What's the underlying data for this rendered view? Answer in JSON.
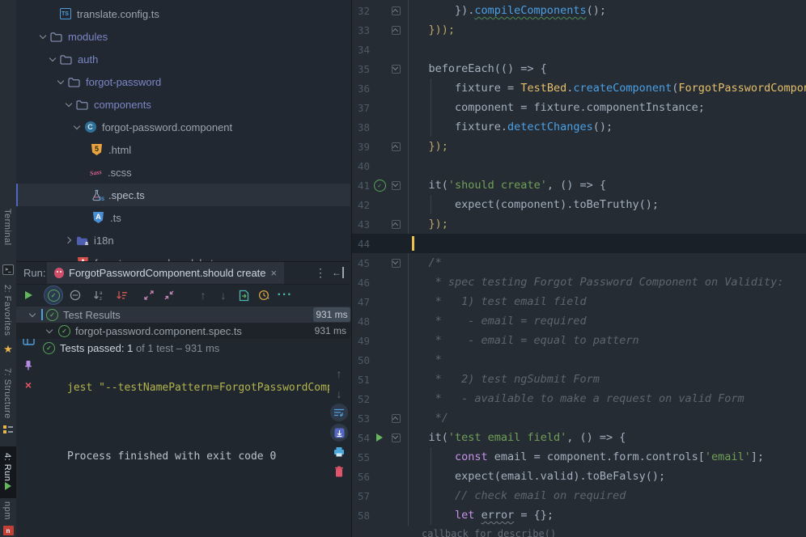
{
  "colors": {
    "accent_green": "#64b75d",
    "status_green": "#57a559",
    "error_red": "#e05561",
    "folder_blue": "#7b87c6",
    "keyword_purple": "#c792ea",
    "string_green": "#70a157",
    "class_yellow": "#e5bf6a",
    "method_blue": "#4aa0e5",
    "console_command_yellow": "#b3b44d"
  },
  "stripe": {
    "items": [
      {
        "id": "terminal",
        "label": "Terminal",
        "active": false
      },
      {
        "id": "favorites",
        "label": "2: Favorites",
        "active": false
      },
      {
        "id": "structure",
        "label": "7: Structure",
        "active": false
      },
      {
        "id": "run",
        "label": "4: Run",
        "active": true
      },
      {
        "id": "npm",
        "label": "npm",
        "active": false
      }
    ]
  },
  "project_tree": {
    "items": [
      {
        "label": "translate.config.ts",
        "icon": "ts-file",
        "indent": 52
      },
      {
        "label": "modules",
        "icon": "folder",
        "chevron": "open",
        "indent": 28,
        "kind": "folder"
      },
      {
        "label": "auth",
        "icon": "folder",
        "chevron": "open",
        "indent": 40,
        "kind": "folder"
      },
      {
        "label": "forgot-password",
        "icon": "folder",
        "chevron": "open",
        "indent": 50,
        "kind": "folder"
      },
      {
        "label": "components",
        "icon": "folder",
        "chevron": "open",
        "indent": 60,
        "kind": "folder"
      },
      {
        "label": "forgot-password.component",
        "icon": "component",
        "chevron": "open",
        "indent": 70
      },
      {
        "label": ".html",
        "icon": "html",
        "indent": 91
      },
      {
        "label": ".scss",
        "icon": "sass",
        "indent": 90
      },
      {
        "label": ".spec.ts",
        "icon": "spec",
        "indent": 91,
        "selected": true
      },
      {
        "label": ".ts",
        "icon": "angular-blue",
        "indent": 93
      },
      {
        "label": "i18n",
        "icon": "i18n-folder",
        "chevron": "closed",
        "indent": 60
      },
      {
        "label": "forgot-password.module.ts",
        "icon": "angular-red",
        "indent": 74
      }
    ]
  },
  "run_panel": {
    "run_label": "Run:",
    "tab": {
      "title": "ForgotPasswordComponent.should create",
      "close": "×"
    },
    "tree": [
      {
        "label": "Test Results",
        "time": "931 ms"
      },
      {
        "label": "forgot-password.component.spec.ts",
        "time": "931 ms"
      }
    ],
    "status": {
      "strong": "Tests passed: 1",
      "muted": " of 1 test – 931 ms"
    },
    "console": {
      "command": "jest \"--testNamePattern=ForgotPasswordComponent s",
      "result": "Process finished with exit code 0"
    }
  },
  "editor": {
    "footer": "callback for describe()",
    "lines": [
      {
        "num": 32,
        "fold": "up",
        "tokens": [
          [
            "p",
            "        })."
          ],
          [
            "fng",
            "compileComponents"
          ],
          [
            "p",
            "();"
          ]
        ]
      },
      {
        "num": 33,
        "fold": "up",
        "tokens": [
          [
            "brace",
            "    }));"
          ]
        ]
      },
      {
        "num": 34,
        "tokens": []
      },
      {
        "num": 35,
        "fold": "down",
        "tokens": [
          [
            "p",
            "    beforeEach(() => {"
          ]
        ]
      },
      {
        "num": 36,
        "tokens": [
          [
            "p",
            "        fixture = "
          ],
          [
            "cls",
            "TestBed"
          ],
          [
            "p",
            "."
          ],
          [
            "fn",
            "createComponent"
          ],
          [
            "p",
            "("
          ],
          [
            "cls",
            "ForgotPasswordComponent"
          ],
          [
            "p",
            ");"
          ]
        ]
      },
      {
        "num": 37,
        "tokens": [
          [
            "p",
            "        component = fixture.componentInstance;"
          ]
        ]
      },
      {
        "num": 38,
        "tokens": [
          [
            "p",
            "        fixture."
          ],
          [
            "fn",
            "detectChanges"
          ],
          [
            "p",
            "();"
          ]
        ]
      },
      {
        "num": 39,
        "fold": "up",
        "tokens": [
          [
            "brace",
            "    });"
          ]
        ]
      },
      {
        "num": 40,
        "tokens": []
      },
      {
        "num": 41,
        "fold": "down",
        "mark": "check",
        "tokens": [
          [
            "p",
            "    it("
          ],
          [
            "str",
            "'should create'"
          ],
          [
            "p",
            ", () => {"
          ]
        ]
      },
      {
        "num": 42,
        "tokens": [
          [
            "p",
            "        expect(component).toBeTruthy();"
          ]
        ]
      },
      {
        "num": 43,
        "fold": "up",
        "tokens": [
          [
            "brace",
            "    });"
          ]
        ]
      },
      {
        "num": 44,
        "current": true,
        "tokens": []
      },
      {
        "num": 45,
        "fold": "down",
        "tokens": [
          [
            "cmt",
            "    /*"
          ]
        ]
      },
      {
        "num": 46,
        "tokens": [
          [
            "cmt",
            "     * spec testing Forgot Password Component on Validity:"
          ]
        ]
      },
      {
        "num": 47,
        "tokens": [
          [
            "cmt",
            "     *   1) test email field"
          ]
        ]
      },
      {
        "num": 48,
        "tokens": [
          [
            "cmt",
            "     *    - email = required"
          ]
        ]
      },
      {
        "num": 49,
        "tokens": [
          [
            "cmt",
            "     *    - email = equal to pattern"
          ]
        ]
      },
      {
        "num": 50,
        "tokens": [
          [
            "cmt",
            "     *"
          ]
        ]
      },
      {
        "num": 51,
        "tokens": [
          [
            "cmt",
            "     *   2) test ngSubmit Form"
          ]
        ]
      },
      {
        "num": 52,
        "tokens": [
          [
            "cmt",
            "     *   - available to make a request on valid Form"
          ]
        ]
      },
      {
        "num": 53,
        "fold": "up",
        "tokens": [
          [
            "cmt",
            "     */"
          ]
        ]
      },
      {
        "num": 54,
        "fold": "down",
        "mark": "play",
        "tokens": [
          [
            "p",
            "    it("
          ],
          [
            "str",
            "'test email field'"
          ],
          [
            "p",
            ", () => {"
          ]
        ]
      },
      {
        "num": 55,
        "tokens": [
          [
            "p",
            "        "
          ],
          [
            "kw",
            "const"
          ],
          [
            "p",
            " email = component.form.controls["
          ],
          [
            "str",
            "'email'"
          ],
          [
            "p",
            "];"
          ]
        ]
      },
      {
        "num": 56,
        "tokens": [
          [
            "p",
            "        expect(email.valid).toBeFalsy();"
          ]
        ]
      },
      {
        "num": 57,
        "tokens": [
          [
            "cmt",
            "        // check email on required"
          ]
        ]
      },
      {
        "num": 58,
        "tokens": [
          [
            "p",
            "        "
          ],
          [
            "kw",
            "let"
          ],
          [
            "p",
            " "
          ],
          [
            "err",
            "error"
          ],
          [
            "p",
            " = {};"
          ]
        ]
      }
    ]
  }
}
